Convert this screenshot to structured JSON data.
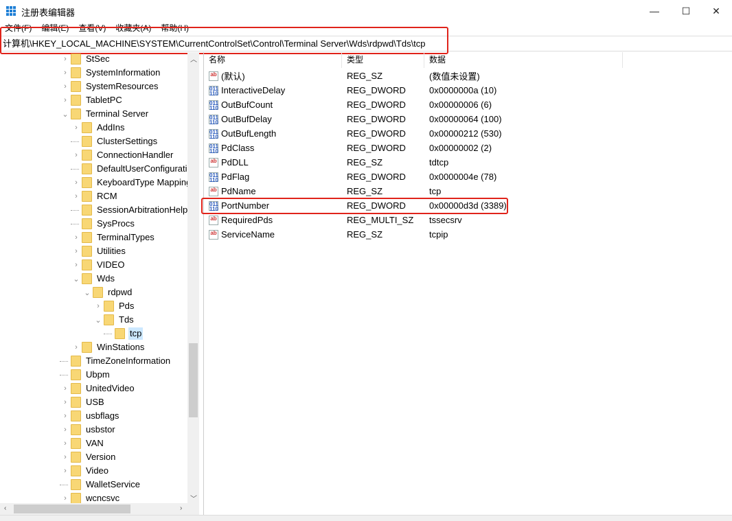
{
  "window": {
    "title": "注册表编辑器",
    "minimize": "—",
    "maximize": "☐",
    "close": "✕"
  },
  "menu": [
    "文件(F)",
    "编辑(E)",
    "查看(V)",
    "收藏夹(A)",
    "帮助(H)"
  ],
  "address": "计算机\\HKEY_LOCAL_MACHINE\\SYSTEM\\CurrentControlSet\\Control\\Terminal Server\\Wds\\rdpwd\\Tds\\tcp",
  "tree": [
    {
      "label": "StSec",
      "level": 1,
      "state": "collapsed"
    },
    {
      "label": "SystemInformation",
      "level": 1,
      "state": "collapsed"
    },
    {
      "label": "SystemResources",
      "level": 1,
      "state": "collapsed"
    },
    {
      "label": "TabletPC",
      "level": 1,
      "state": "collapsed"
    },
    {
      "label": "Terminal Server",
      "level": 1,
      "state": "expanded"
    },
    {
      "label": "AddIns",
      "level": 2,
      "state": "collapsed"
    },
    {
      "label": "ClusterSettings",
      "level": 2,
      "state": "leaf"
    },
    {
      "label": "ConnectionHandler",
      "level": 2,
      "state": "collapsed"
    },
    {
      "label": "DefaultUserConfiguration",
      "level": 2,
      "state": "leaf"
    },
    {
      "label": "KeyboardType Mapping",
      "level": 2,
      "state": "collapsed"
    },
    {
      "label": "RCM",
      "level": 2,
      "state": "collapsed"
    },
    {
      "label": "SessionArbitrationHelper",
      "level": 2,
      "state": "leaf"
    },
    {
      "label": "SysProcs",
      "level": 2,
      "state": "leaf"
    },
    {
      "label": "TerminalTypes",
      "level": 2,
      "state": "collapsed"
    },
    {
      "label": "Utilities",
      "level": 2,
      "state": "collapsed"
    },
    {
      "label": "VIDEO",
      "level": 2,
      "state": "collapsed"
    },
    {
      "label": "Wds",
      "level": 2,
      "state": "expanded"
    },
    {
      "label": "rdpwd",
      "level": 3,
      "state": "expanded"
    },
    {
      "label": "Pds",
      "level": 4,
      "state": "collapsed"
    },
    {
      "label": "Tds",
      "level": 4,
      "state": "expanded"
    },
    {
      "label": "tcp",
      "level": 5,
      "state": "leaf",
      "selected": true
    },
    {
      "label": "WinStations",
      "level": 2,
      "state": "collapsed"
    },
    {
      "label": "TimeZoneInformation",
      "level": 1,
      "state": "leaf"
    },
    {
      "label": "Ubpm",
      "level": 1,
      "state": "leaf"
    },
    {
      "label": "UnitedVideo",
      "level": 1,
      "state": "collapsed"
    },
    {
      "label": "USB",
      "level": 1,
      "state": "collapsed"
    },
    {
      "label": "usbflags",
      "level": 1,
      "state": "collapsed"
    },
    {
      "label": "usbstor",
      "level": 1,
      "state": "collapsed"
    },
    {
      "label": "VAN",
      "level": 1,
      "state": "collapsed"
    },
    {
      "label": "Version",
      "level": 1,
      "state": "collapsed"
    },
    {
      "label": "Video",
      "level": 1,
      "state": "collapsed"
    },
    {
      "label": "WalletService",
      "level": 1,
      "state": "leaf"
    },
    {
      "label": "wcncsvc",
      "level": 1,
      "state": "collapsed"
    }
  ],
  "list": {
    "headers": [
      "名称",
      "类型",
      "数据"
    ],
    "rows": [
      {
        "name": "(默认)",
        "type": "REG_SZ",
        "data": "(数值未设置)",
        "icon": "string-value-icon"
      },
      {
        "name": "InteractiveDelay",
        "type": "REG_DWORD",
        "data": "0x0000000a (10)",
        "icon": "binary-value-icon"
      },
      {
        "name": "OutBufCount",
        "type": "REG_DWORD",
        "data": "0x00000006 (6)",
        "icon": "binary-value-icon"
      },
      {
        "name": "OutBufDelay",
        "type": "REG_DWORD",
        "data": "0x00000064 (100)",
        "icon": "binary-value-icon"
      },
      {
        "name": "OutBufLength",
        "type": "REG_DWORD",
        "data": "0x00000212 (530)",
        "icon": "binary-value-icon"
      },
      {
        "name": "PdClass",
        "type": "REG_DWORD",
        "data": "0x00000002 (2)",
        "icon": "binary-value-icon"
      },
      {
        "name": "PdDLL",
        "type": "REG_SZ",
        "data": "tdtcp",
        "icon": "string-value-icon"
      },
      {
        "name": "PdFlag",
        "type": "REG_DWORD",
        "data": "0x0000004e (78)",
        "icon": "binary-value-icon"
      },
      {
        "name": "PdName",
        "type": "REG_SZ",
        "data": "tcp",
        "icon": "string-value-icon"
      },
      {
        "name": "PortNumber",
        "type": "REG_DWORD",
        "data": "0x00000d3d (3389)",
        "icon": "binary-value-icon",
        "highlighted": true
      },
      {
        "name": "RequiredPds",
        "type": "REG_MULTI_SZ",
        "data": "tssecsrv",
        "icon": "string-value-icon"
      },
      {
        "name": "ServiceName",
        "type": "REG_SZ",
        "data": "tcpip",
        "icon": "string-value-icon"
      }
    ]
  },
  "colors": {
    "highlight": "#e0231a",
    "selection": "#cce8ff",
    "folder": "#f8d775"
  }
}
